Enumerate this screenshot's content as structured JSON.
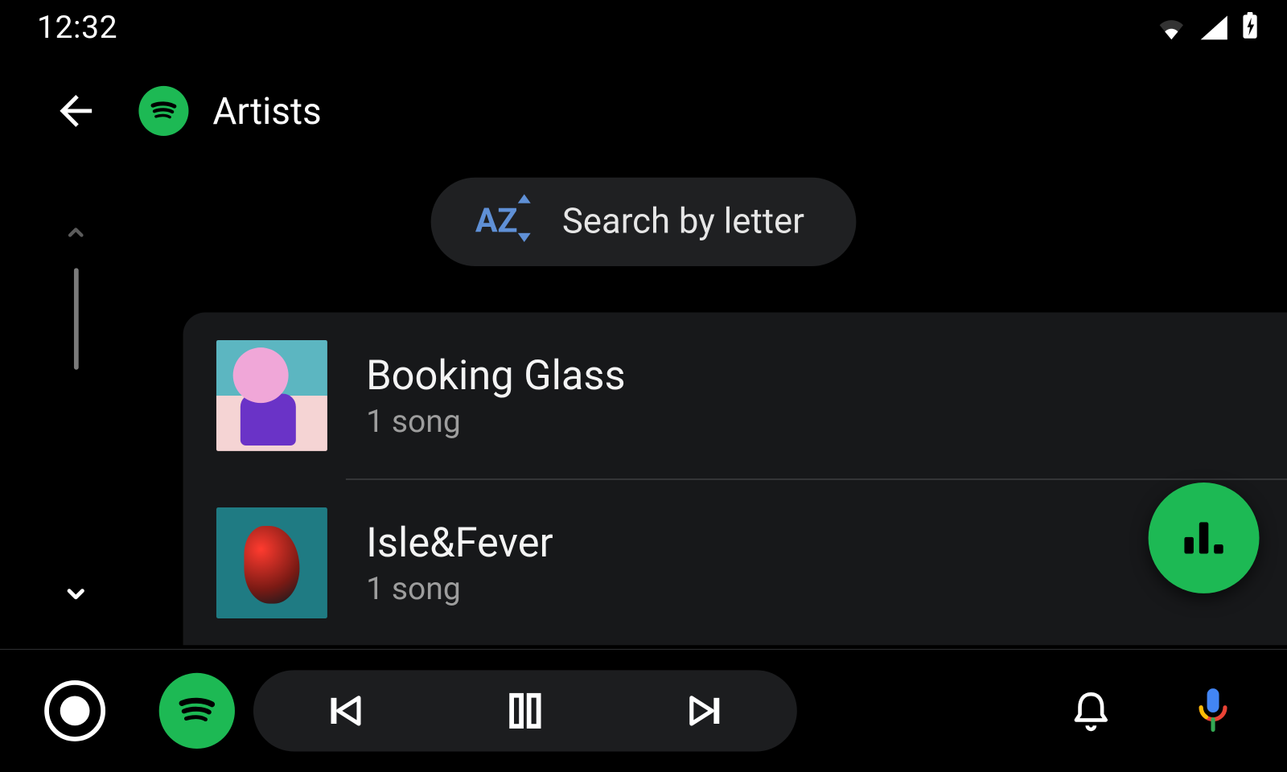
{
  "status": {
    "time": "12:32"
  },
  "header": {
    "title": "Artists"
  },
  "search_chip": {
    "label": "Search by letter"
  },
  "artists": [
    {
      "name": "Booking Glass",
      "subtitle": "1 song"
    },
    {
      "name": "Isle&Fever",
      "subtitle": "1 song"
    }
  ],
  "colors": {
    "accent": "#1DB954",
    "link": "#5F90D6"
  }
}
